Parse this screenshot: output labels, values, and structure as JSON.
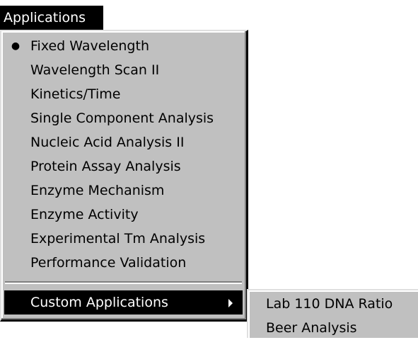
{
  "menubar": {
    "title": "Applications"
  },
  "menu": {
    "items": [
      {
        "label": "Fixed Wavelength",
        "checked": true
      },
      {
        "label": "Wavelength Scan II"
      },
      {
        "label": "Kinetics/Time"
      },
      {
        "label": "Single Component Analysis"
      },
      {
        "label": "Nucleic Acid Analysis II"
      },
      {
        "label": "Protein Assay Analysis"
      },
      {
        "label": "Enzyme Mechanism"
      },
      {
        "label": "Enzyme Activity"
      },
      {
        "label": "Experimental Tm Analysis"
      },
      {
        "label": "Performance Validation"
      }
    ],
    "custom": {
      "label": "Custom Applications",
      "highlighted": true,
      "icon": "chevron-right-icon"
    }
  },
  "submenu": {
    "items": [
      {
        "label": "Lab 110 DNA Ratio"
      },
      {
        "label": "Beer Analysis"
      }
    ]
  },
  "colors": {
    "menu_bg": "#c0c0c0",
    "highlight_bg": "#000000",
    "highlight_text": "#ffffff"
  }
}
